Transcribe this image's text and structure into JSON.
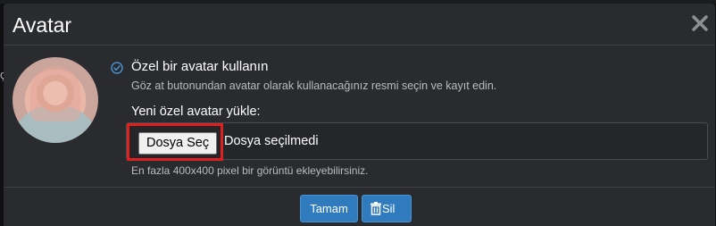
{
  "modal": {
    "title": "Avatar"
  },
  "custom_avatar": {
    "title": "Özel bir avatar kullanın",
    "description": "Göz at butonundan avatar olarak kullanacağınız resmi seçin ve kayıt edin.",
    "upload_label": "Yeni özel avatar yükle:",
    "file_button": "Dosya Seç",
    "file_status": "Dosya seçilmedi",
    "hint": "En fazla 400x400 pixel bir görüntü ekleyebilirsiniz."
  },
  "footer": {
    "ok_label": "Tamam",
    "delete_label": "Sil"
  },
  "background": {
    "edge_char": "ç"
  },
  "icons": {
    "close": "close-icon",
    "check": "check-circle-icon",
    "trash": "trash-icon"
  },
  "colors": {
    "accent": "#2f7bbd",
    "highlight": "#e02020",
    "modal_bg": "#2a2b2e"
  }
}
